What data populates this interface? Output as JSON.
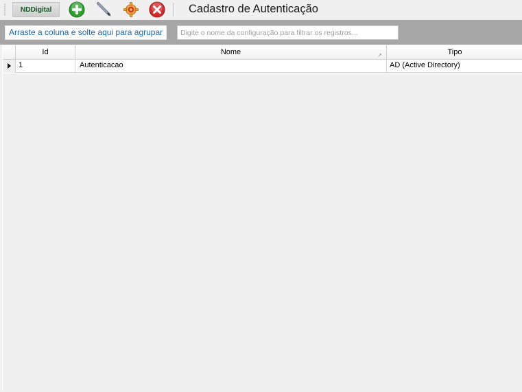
{
  "toolbar": {
    "logo_text": "NDDigital",
    "icons": [
      "add-icon",
      "edit-pencil-icon",
      "settings-gear-icon",
      "delete-x-icon"
    ],
    "title": "Cadastro de Autenticação"
  },
  "groupbar": {
    "group_hint": "Arraste a coluna e solte aqui para agrupar",
    "filter_placeholder": "Digite o nome da configuração para filtrar os registros..."
  },
  "grid": {
    "columns": [
      "Id",
      "Nome",
      "Tipo"
    ],
    "rows": [
      {
        "id": "1",
        "nome": "Autenticacao",
        "tipo": "AD (Active Directory)"
      }
    ]
  },
  "colors": {
    "add": "#2e9e2e",
    "delete": "#d42a2a",
    "group_text": "#1b66b3",
    "groupbar_bg": "#a6a6a6"
  }
}
